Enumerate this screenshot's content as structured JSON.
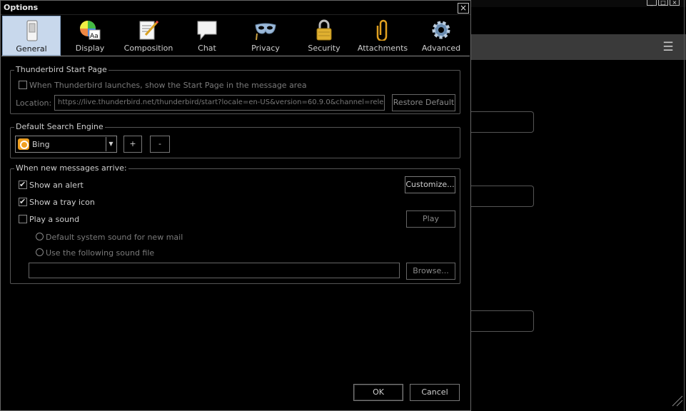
{
  "background_window": {
    "window_buttons": [
      "_",
      "□",
      "×"
    ],
    "menu_icon": "hamburger-icon"
  },
  "dialog": {
    "title": "Options",
    "close_glyph": "×"
  },
  "tabs": [
    {
      "label": "General",
      "icon": "switch-icon",
      "active": true
    },
    {
      "label": "Display",
      "icon": "display-icon",
      "active": false
    },
    {
      "label": "Composition",
      "icon": "composition-icon",
      "active": false
    },
    {
      "label": "Chat",
      "icon": "chat-icon",
      "active": false
    },
    {
      "label": "Privacy",
      "icon": "privacy-mask-icon",
      "active": false
    },
    {
      "label": "Security",
      "icon": "padlock-icon",
      "active": false
    },
    {
      "label": "Attachments",
      "icon": "paperclip-icon",
      "active": false
    },
    {
      "label": "Advanced",
      "icon": "gear-icon",
      "active": false
    }
  ],
  "start_page": {
    "legend": "Thunderbird Start Page",
    "checkbox_label": "When Thunderbird launches, show the Start Page in the message area",
    "checked": false,
    "location_label": "Location:",
    "location_value": "https://live.thunderbird.net/thunderbird/start?locale=en-US&version=60.9.0&channel=releas",
    "restore_button": "Restore Default"
  },
  "search_engine": {
    "legend": "Default Search Engine",
    "selected": "Bing",
    "add_button": "+",
    "remove_button": "-"
  },
  "new_messages": {
    "legend": "When new messages arrive:",
    "show_alert_label": "Show an alert",
    "show_alert_checked": true,
    "customize_button": "Customize...",
    "tray_icon_label": "Show a tray icon",
    "tray_icon_checked": true,
    "play_sound_label": "Play a sound",
    "play_sound_checked": false,
    "play_button": "Play",
    "default_sound_label": "Default system sound for new mail",
    "use_file_label": "Use the following sound file",
    "sound_file_value": "",
    "browse_button": "Browse..."
  },
  "footer": {
    "ok_button": "OK",
    "cancel_button": "Cancel"
  },
  "colors": {
    "active_tab_bg": "#c8d8ec",
    "background": "#000000",
    "toolbar_gray": "#3a3a3a"
  }
}
